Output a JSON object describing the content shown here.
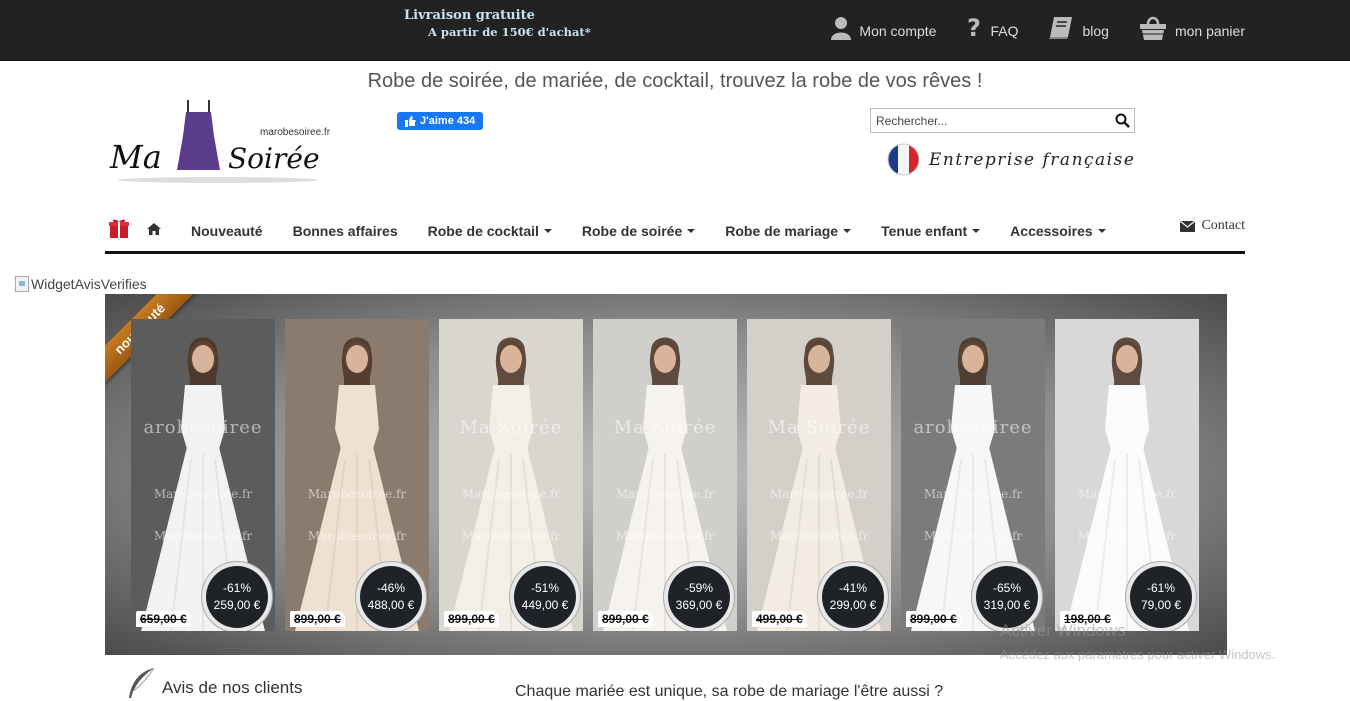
{
  "topbar": {
    "promo_line1": "Livraison gratuite",
    "promo_line2": "A partir de 150€ d'achat*",
    "links": [
      {
        "label": "Mon compte",
        "icon": "user-icon"
      },
      {
        "label": "FAQ",
        "icon": "question-icon"
      },
      {
        "label": "blog",
        "icon": "book-icon"
      },
      {
        "label": "mon panier",
        "icon": "basket-icon"
      }
    ]
  },
  "header": {
    "tagline": "Robe de soirée, de mariée, de cocktail, trouvez la robe de vos rêves !",
    "logo_site": "marobesoiree.fr",
    "logo_word1": "Ma",
    "logo_word2": "Soirée",
    "fb_like": "J'aime 434",
    "search_placeholder": "Rechercher...",
    "entreprise": "Entreprise française"
  },
  "nav": {
    "items": [
      {
        "label": "Nouveauté",
        "dropdown": false
      },
      {
        "label": "Bonnes affaires",
        "dropdown": false
      },
      {
        "label": "Robe de cocktail",
        "dropdown": true
      },
      {
        "label": "Robe de soirée",
        "dropdown": true
      },
      {
        "label": "Robe de mariage",
        "dropdown": true
      },
      {
        "label": "Tenue enfant",
        "dropdown": true
      },
      {
        "label": "Accessoires",
        "dropdown": true
      }
    ],
    "contact": "Contact"
  },
  "widget_alt": "WidgetAvisVerifies",
  "carousel": {
    "ribbon": "nouveauté",
    "products": [
      {
        "discount": "-61%",
        "price": "259,00 €",
        "old_price": "659,00 €",
        "watermark": "arobesoiree",
        "bg": "#5c5c5c",
        "dress": "#f2f2f2"
      },
      {
        "discount": "-46%",
        "price": "488,00 €",
        "old_price": "899,00 €",
        "watermark": "",
        "bg": "#8a7b6e",
        "dress": "#efe1d2"
      },
      {
        "discount": "-51%",
        "price": "449,00 €",
        "old_price": "899,00 €",
        "watermark": "Ma Soirée",
        "bg": "#d9d6d0",
        "dress": "#f4efe6"
      },
      {
        "discount": "-59%",
        "price": "369,00 €",
        "old_price": "899,00 €",
        "watermark": "Ma Soirée",
        "bg": "#cfcfcc",
        "dress": "#f6f3ee"
      },
      {
        "discount": "-41%",
        "price": "299,00 €",
        "old_price": "499,00 €",
        "watermark": "Ma Soirée",
        "bg": "#d3d0ca",
        "dress": "#f2ece3"
      },
      {
        "discount": "-65%",
        "price": "319,00 €",
        "old_price": "899,00 €",
        "watermark": "arobesoiree",
        "bg": "#7b7b7b",
        "dress": "#f7f7f7"
      },
      {
        "discount": "-61%",
        "price": "79,00 €",
        "old_price": "198,00 €",
        "watermark": "",
        "bg": "#d8d8d8",
        "dress": "#fbfbfb"
      }
    ],
    "watermark_line2": "Marobesoiree.fr",
    "watermark_line3": "Marobesoiree.fr"
  },
  "windows": {
    "line1": "Activer Windows",
    "line2": "Accédez aux paramètres pour activer Windows."
  },
  "footer": {
    "avis": "Avis de nos clients",
    "bottom_text": "Chaque mariée est unique, sa robe de mariage l'être aussi ?"
  },
  "colors": {
    "topbar": "#222222",
    "promo_text": "#c9e3ee",
    "fb_blue": "#1877f2",
    "ribbon": "#b06a1a",
    "badge": "#1f2328"
  }
}
